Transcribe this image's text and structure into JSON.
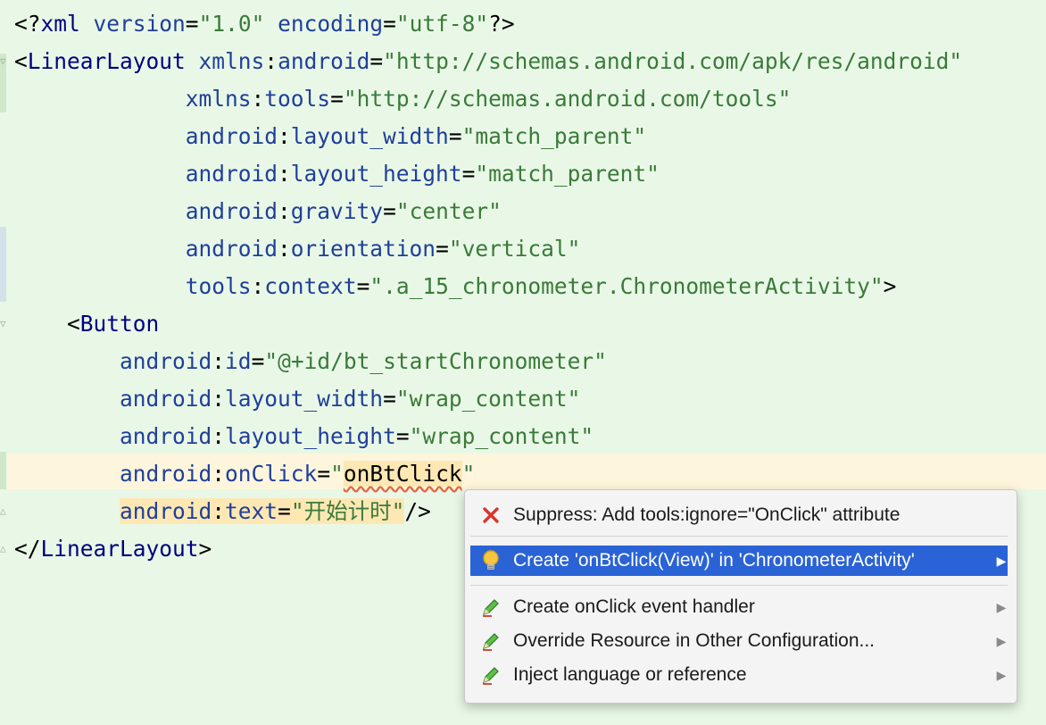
{
  "editor": {
    "lines": [
      {
        "parts": [
          [
            "pi",
            "<?"
          ],
          [
            "kw",
            "xml "
          ],
          [
            "at",
            "version"
          ],
          [
            "punc",
            "="
          ],
          [
            "val",
            "\"1.0\""
          ],
          [
            "at",
            " encoding"
          ],
          [
            "punc",
            "="
          ],
          [
            "val",
            "\"utf-8\""
          ],
          [
            "pi",
            "?>"
          ]
        ]
      },
      {
        "parts": [
          [
            "punc",
            "<"
          ],
          [
            "tag",
            "LinearLayout "
          ],
          [
            "ns",
            "xmlns"
          ],
          [
            "punc",
            ":"
          ],
          [
            "at",
            "android"
          ],
          [
            "punc",
            "="
          ],
          [
            "val",
            "\"http://schemas.android.com/apk/res/android\""
          ]
        ]
      },
      {
        "parts": [
          [
            "punc",
            "             "
          ],
          [
            "ns",
            "xmlns"
          ],
          [
            "punc",
            ":"
          ],
          [
            "at",
            "tools"
          ],
          [
            "punc",
            "="
          ],
          [
            "val",
            "\"http://schemas.android.com/tools\""
          ]
        ]
      },
      {
        "parts": [
          [
            "punc",
            "             "
          ],
          [
            "ns",
            "android"
          ],
          [
            "punc",
            ":"
          ],
          [
            "at",
            "layout_width"
          ],
          [
            "punc",
            "="
          ],
          [
            "val",
            "\"match_parent\""
          ]
        ]
      },
      {
        "parts": [
          [
            "punc",
            "             "
          ],
          [
            "ns",
            "android"
          ],
          [
            "punc",
            ":"
          ],
          [
            "at",
            "layout_height"
          ],
          [
            "punc",
            "="
          ],
          [
            "val",
            "\"match_parent\""
          ]
        ]
      },
      {
        "parts": [
          [
            "punc",
            "             "
          ],
          [
            "ns",
            "android"
          ],
          [
            "punc",
            ":"
          ],
          [
            "at",
            "gravity"
          ],
          [
            "punc",
            "="
          ],
          [
            "val",
            "\"center\""
          ]
        ]
      },
      {
        "parts": [
          [
            "punc",
            "             "
          ],
          [
            "ns",
            "android"
          ],
          [
            "punc",
            ":"
          ],
          [
            "at",
            "orientation"
          ],
          [
            "punc",
            "="
          ],
          [
            "val",
            "\"vertical\""
          ]
        ]
      },
      {
        "parts": [
          [
            "punc",
            "             "
          ],
          [
            "ns",
            "tools"
          ],
          [
            "punc",
            ":"
          ],
          [
            "at",
            "context"
          ],
          [
            "punc",
            "="
          ],
          [
            "val",
            "\".a_15_chronometer.ChronometerActivity\""
          ],
          [
            "punc",
            ">"
          ]
        ]
      },
      {
        "parts": [
          [
            "punc",
            "    <"
          ],
          [
            "tag",
            "Button"
          ]
        ]
      },
      {
        "parts": [
          [
            "punc",
            "        "
          ],
          [
            "ns",
            "android"
          ],
          [
            "punc",
            ":"
          ],
          [
            "at",
            "id"
          ],
          [
            "punc",
            "="
          ],
          [
            "val",
            "\"@+id/bt_startChronometer\""
          ]
        ]
      },
      {
        "parts": [
          [
            "punc",
            "        "
          ],
          [
            "ns",
            "android"
          ],
          [
            "punc",
            ":"
          ],
          [
            "at",
            "layout_width"
          ],
          [
            "punc",
            "="
          ],
          [
            "val",
            "\"wrap_content\""
          ]
        ]
      },
      {
        "parts": [
          [
            "punc",
            "        "
          ],
          [
            "ns",
            "android"
          ],
          [
            "punc",
            ":"
          ],
          [
            "at",
            "layout_height"
          ],
          [
            "punc",
            "="
          ],
          [
            "val",
            "\"wrap_content\""
          ]
        ]
      },
      {
        "parts": [
          [
            "punc",
            "        "
          ],
          [
            "ns",
            "android"
          ],
          [
            "punc",
            ":"
          ],
          [
            "at",
            "onClick"
          ],
          [
            "punc",
            "="
          ],
          [
            "val",
            "\""
          ],
          [
            "err",
            "onBtClick"
          ],
          [
            "val",
            "\""
          ]
        ]
      },
      {
        "parts": [
          [
            "punc",
            "        "
          ],
          [
            "wns",
            "android"
          ],
          [
            "wpunc",
            ":"
          ],
          [
            "wat",
            "text"
          ],
          [
            "wpunc",
            "="
          ],
          [
            "wval",
            "\"开始计时\""
          ],
          [
            "punc",
            "/>"
          ]
        ]
      },
      {
        "parts": [
          [
            "punc",
            "</"
          ],
          [
            "tag",
            "LinearLayout"
          ],
          [
            "punc",
            ">"
          ]
        ]
      }
    ]
  },
  "popup": {
    "items": [
      {
        "label": "Suppress: Add tools:ignore=\"OnClick\" attribute",
        "icon": "error-x-icon",
        "submenu": false,
        "selected": false
      },
      {
        "label": "Create 'onBtClick(View)' in 'ChronometerActivity'",
        "icon": "lightbulb-icon",
        "submenu": true,
        "selected": true
      },
      {
        "label": "Create onClick event handler",
        "icon": "pencil-icon",
        "submenu": true,
        "selected": false
      },
      {
        "label": "Override Resource in Other Configuration...",
        "icon": "pencil-icon",
        "submenu": true,
        "selected": false
      },
      {
        "label": "Inject language or reference",
        "icon": "pencil-icon",
        "submenu": true,
        "selected": false
      }
    ]
  },
  "colors": {
    "background": "#e9f8e6",
    "selection": "#2a63d6",
    "string_value": "#3a7a3a",
    "attribute": "#1f3f9a"
  }
}
